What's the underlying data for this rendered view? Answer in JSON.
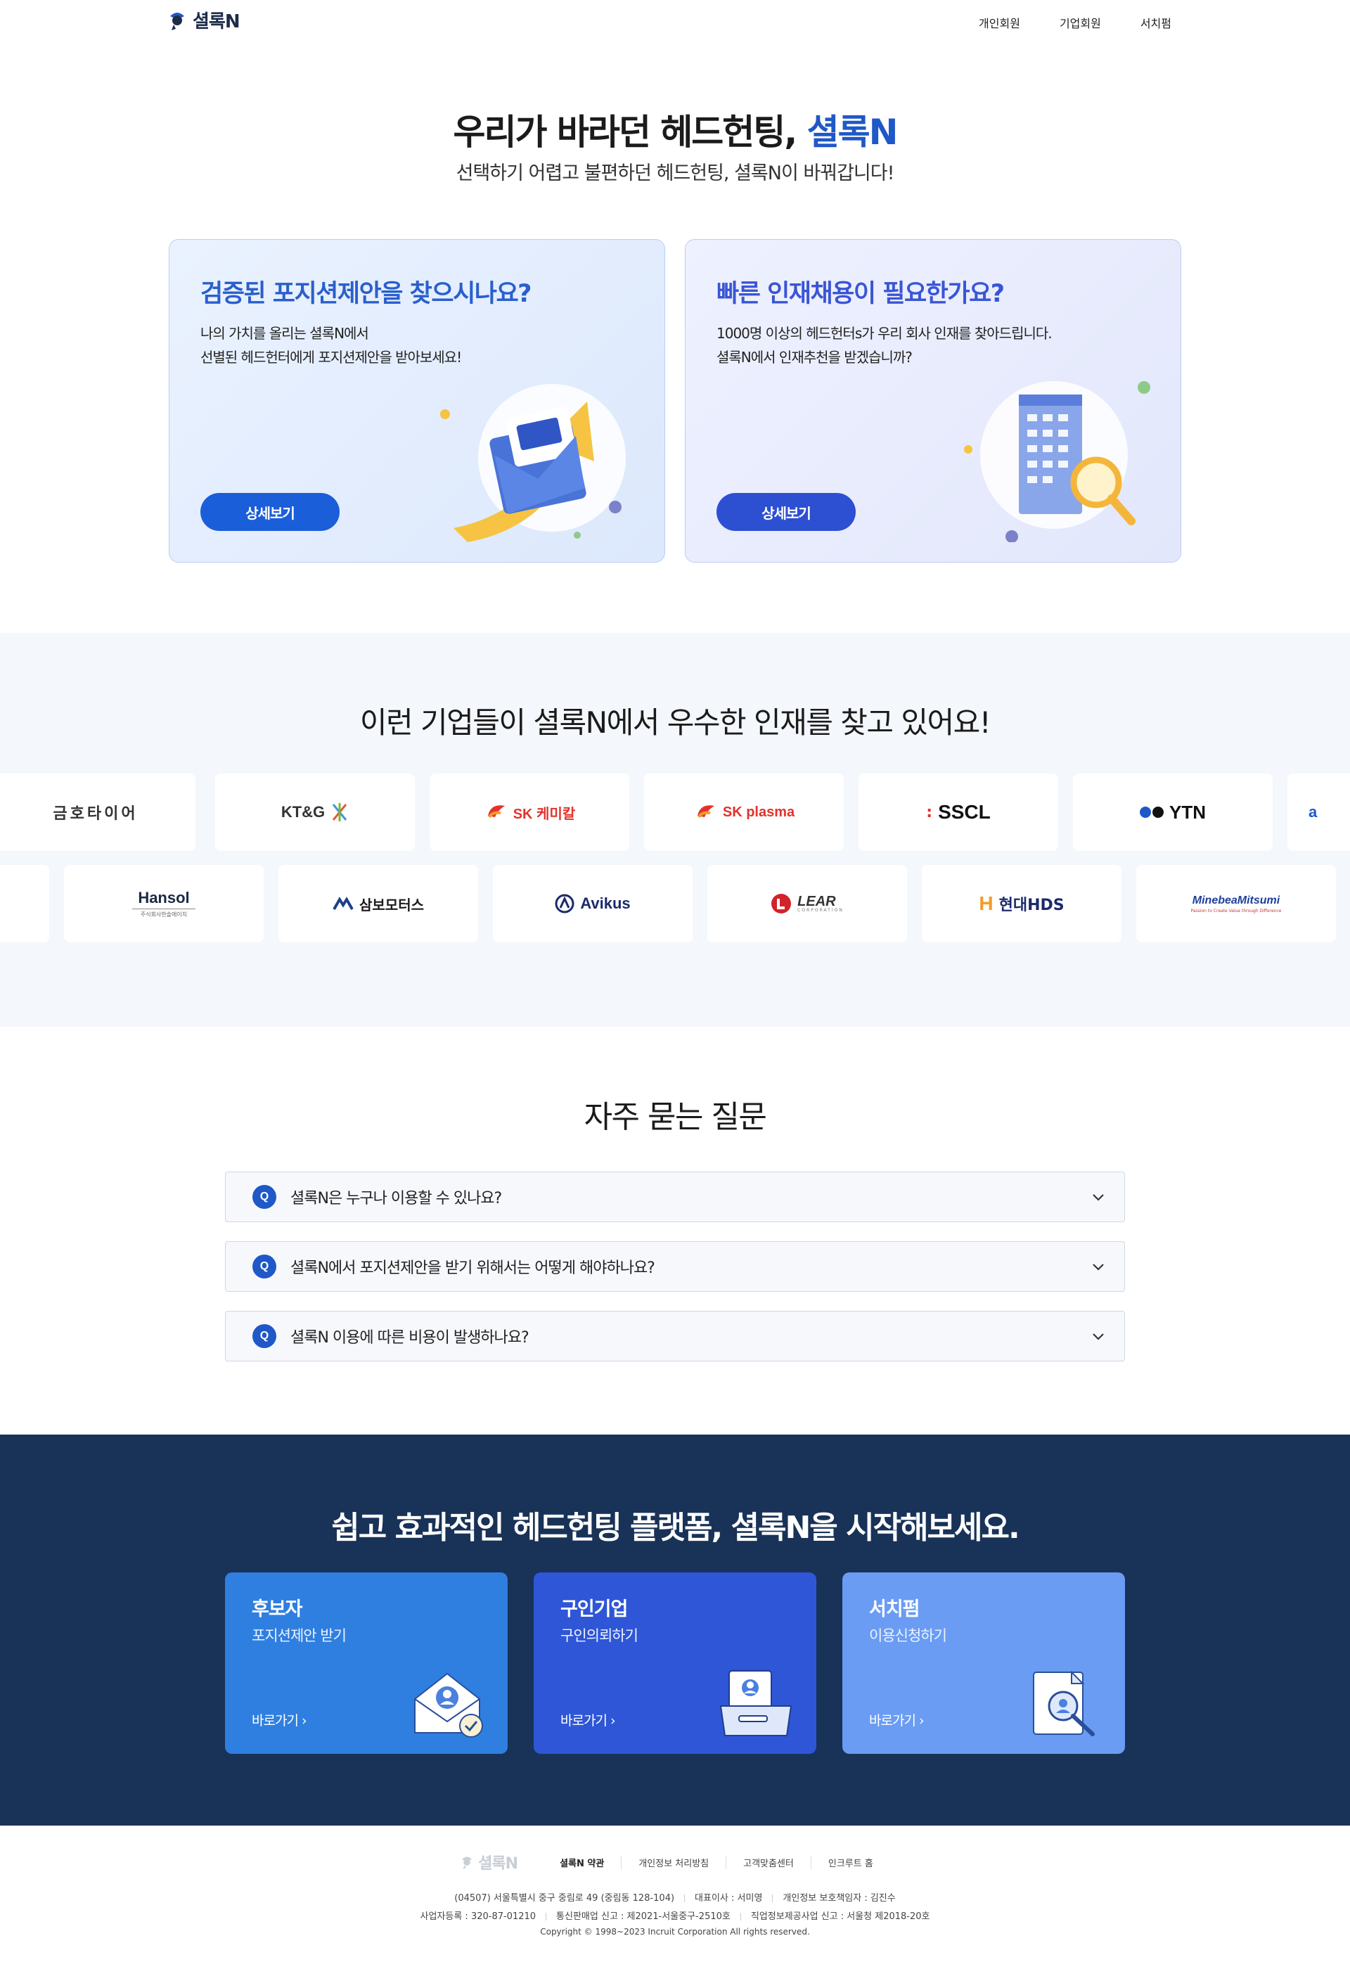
{
  "header": {
    "logo_text": "셜록N",
    "nav": [
      "개인회원",
      "기업회원",
      "서치펌"
    ]
  },
  "hero": {
    "title_prefix": "우리가 바라던 헤드헌팅, ",
    "title_brand": "셜록N",
    "subtitle": "선택하기 어렵고 불편하던 헤드헌팅, 셜록N이 바꿔갑니다!"
  },
  "cards": [
    {
      "title": "검증된 포지션제안을 찾으시나요?",
      "desc_line1": "나의 가치를 올리는 셜록N에서",
      "desc_line2": "선별된 헤드헌터에게 포지션제안을 받아보세요!",
      "button": "상세보기",
      "icon": "envelope-arrow-icon"
    },
    {
      "title": "빠른 인재채용이 필요한가요?",
      "desc_line1": "1000명 이상의 헤드헌터s가 우리 회사 인재를 찾아드립니다.",
      "desc_line2": "셜록N에서 인재추천을 받겠습니까?",
      "button": "상세보기",
      "icon": "building-magnifier-icon"
    }
  ],
  "companies": {
    "title": "이런 기업들이 셜록N에서 우수한 인재를 찾고 있어요!",
    "row1": [
      "금호타이어",
      "KT&G",
      "SK 케미칼",
      "SK plasma",
      "SSCL",
      "YTN",
      "a"
    ],
    "row2": [
      "Hansol",
      "주식회사한솔에이치",
      "삼보모터스",
      "Avikus",
      "LEAR",
      "CORPORATION",
      "현대HDS",
      "MinebeaMitsumi",
      "Passion to Create Value through Difference"
    ]
  },
  "faq": {
    "title": "자주 묻는 질문",
    "q_badge": "Q",
    "items": [
      "셜록N은 누구나 이용할 수 있나요?",
      "셜록N에서 포지션제안을 받기 위해서는 어떻게 해야하나요?",
      "셜록N 이용에 따른 비용이 발생하나요?"
    ]
  },
  "cta": {
    "title": "쉽고 효과적인 헤드헌팅 플랫폼, 셜록N을 시작해보세요.",
    "cards": [
      {
        "title": "후보자",
        "sub": "포지션제안 받기",
        "go": "바로가기",
        "color": "#2f7fe0",
        "icon": "envelope-person-check-icon"
      },
      {
        "title": "구인기업",
        "sub": "구인의뢰하기",
        "go": "바로가기",
        "color": "#2e56d6",
        "icon": "folder-person-icon"
      },
      {
        "title": "서치펌",
        "sub": "이용신청하기",
        "go": "바로가기",
        "color": "#6a9cf3",
        "icon": "document-search-icon"
      }
    ]
  },
  "footer": {
    "logo": "셜록N",
    "links": [
      "셜록N 약관",
      "개인정보 처리방침",
      "고객맞춤센터",
      "인크루트 홈"
    ],
    "addr": "(04507) 서울특별시 중구 중림로 49 (중림동 128-104)",
    "ceo": "대표이사 : 서미영",
    "privacy_officer": "개인정보 보호책임자 : 김진수",
    "biz_no": "사업자등록 : 320-87-01210",
    "ecommerce": "통신판매업 신고 : 제2021-서울중구-2510호",
    "job_info": "직업정보제공사업 신고 : 서울청 제2018-20호",
    "copyright": "Copyright © 1998~2023 Incruit Corporation All rights reserved."
  }
}
